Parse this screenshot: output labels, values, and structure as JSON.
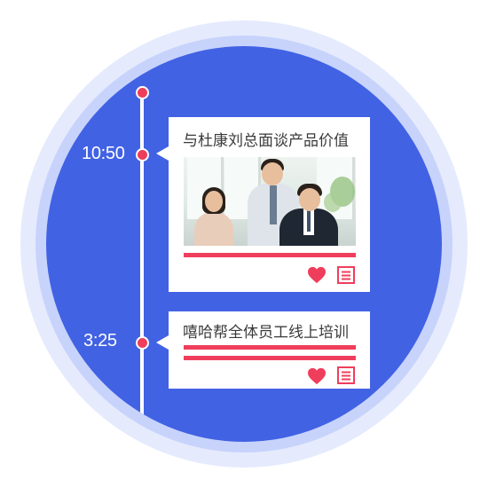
{
  "timeline": {
    "entries": [
      {
        "time": "10:50",
        "title": "与杜康刘总面谈产品价值",
        "has_photo": true,
        "photo_alt": "meeting-photo"
      },
      {
        "time": "3:25",
        "title": "嘻哈帮全体员工线上培训",
        "has_photo": false
      }
    ]
  },
  "colors": {
    "disc": "#4262e4",
    "ring_mid": "#c7d3fb",
    "ring_outer": "#e5ebfd",
    "accent": "#ef3e5b",
    "card": "#ffffff"
  },
  "icons": {
    "like": "heart-icon",
    "note": "note-icon"
  }
}
